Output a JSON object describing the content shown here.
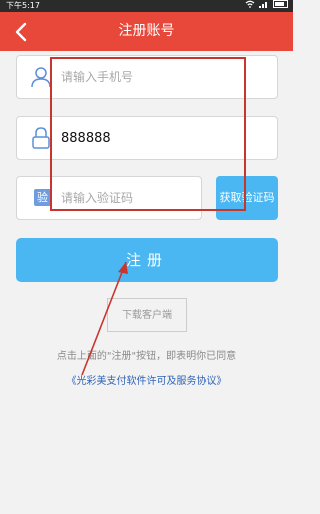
{
  "status_bar": {
    "time": "下午5:17",
    "icons": [
      "wifi-icon",
      "signal-icon",
      "battery-icon"
    ]
  },
  "header": {
    "title": "注册账号",
    "back_icon": "chevron-left-icon",
    "background_color": "#e8483a"
  },
  "form": {
    "phone": {
      "placeholder": "请输入手机号",
      "value": "",
      "icon": "user-icon"
    },
    "password": {
      "placeholder": "",
      "value": "888888",
      "icon": "lock-icon"
    },
    "verification_code": {
      "placeholder": "请输入验证码",
      "value": "",
      "icon_label": "验"
    },
    "get_code_label": "获取验证码",
    "register_label": "注册",
    "accent_color": "#4ab6f2"
  },
  "download_label": "下载客户端",
  "agreement": {
    "notice": "点击上面的\"注册\"按钮，即表明你已同意",
    "link": "《光彩美支付软件许可及服务协议》"
  }
}
